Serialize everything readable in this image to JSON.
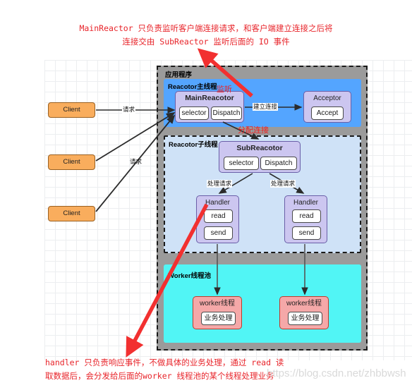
{
  "annotations": {
    "top": "MainReactor 只负责监听客户端连接请求，和客户端建立连接之后将\n连接交由 SubReactor 监听后面的 IO 事件",
    "bottom": "handler 只负责响应事件，不做具体的业务处理，通过 read 读\n取数据后，会分发给后面的worker 线程池的某个线程处理业务"
  },
  "watermark": "https://blog.csdn.net/zhbbwsh",
  "zones": {
    "application": "应用程序",
    "main_thread": "Reacotor主线程",
    "sub_thread": "Reacotor子线程",
    "worker_pool": "Worker线程池"
  },
  "clients": [
    {
      "label": "Client"
    },
    {
      "label": "Client"
    },
    {
      "label": "Client"
    }
  ],
  "nodes": {
    "main_reactor": {
      "title": "MainReacotor",
      "chips": [
        "selector",
        "Dispatch"
      ]
    },
    "acceptor": {
      "title": "Acceptor",
      "chips": [
        "Accept"
      ]
    },
    "sub_reactor": {
      "title": "SubReacotor",
      "chips": [
        "selector",
        "Dispatch"
      ]
    },
    "handlers": [
      {
        "title": "Handler",
        "chips": [
          "read",
          "send"
        ]
      },
      {
        "title": "Handler",
        "chips": [
          "read",
          "send"
        ]
      }
    ],
    "workers": [
      {
        "title": "worker线程",
        "chips": [
          "业务处理"
        ]
      },
      {
        "title": "worker线程",
        "chips": [
          "业务处理"
        ]
      }
    ]
  },
  "edge_labels": {
    "request_1": "请求",
    "request_2": "请求",
    "establish_connection": "建立连接",
    "handle_request_1": "处理请求",
    "handle_request_2": "处理请求"
  },
  "red_labels": {
    "listen": "监听",
    "assign_connection": "分配连接"
  },
  "colors": {
    "annotation_red": "#e8242a",
    "main_thread_blue": "#54a5ff",
    "sub_thread_blue": "#cfe2f7",
    "worker_pool_cyan": "#51f5f5",
    "node_purple": "#ccc6f0",
    "node_pink": "#f5a8a8",
    "client_orange": "#f9ad5d",
    "container_gray": "#9b9b9b"
  }
}
